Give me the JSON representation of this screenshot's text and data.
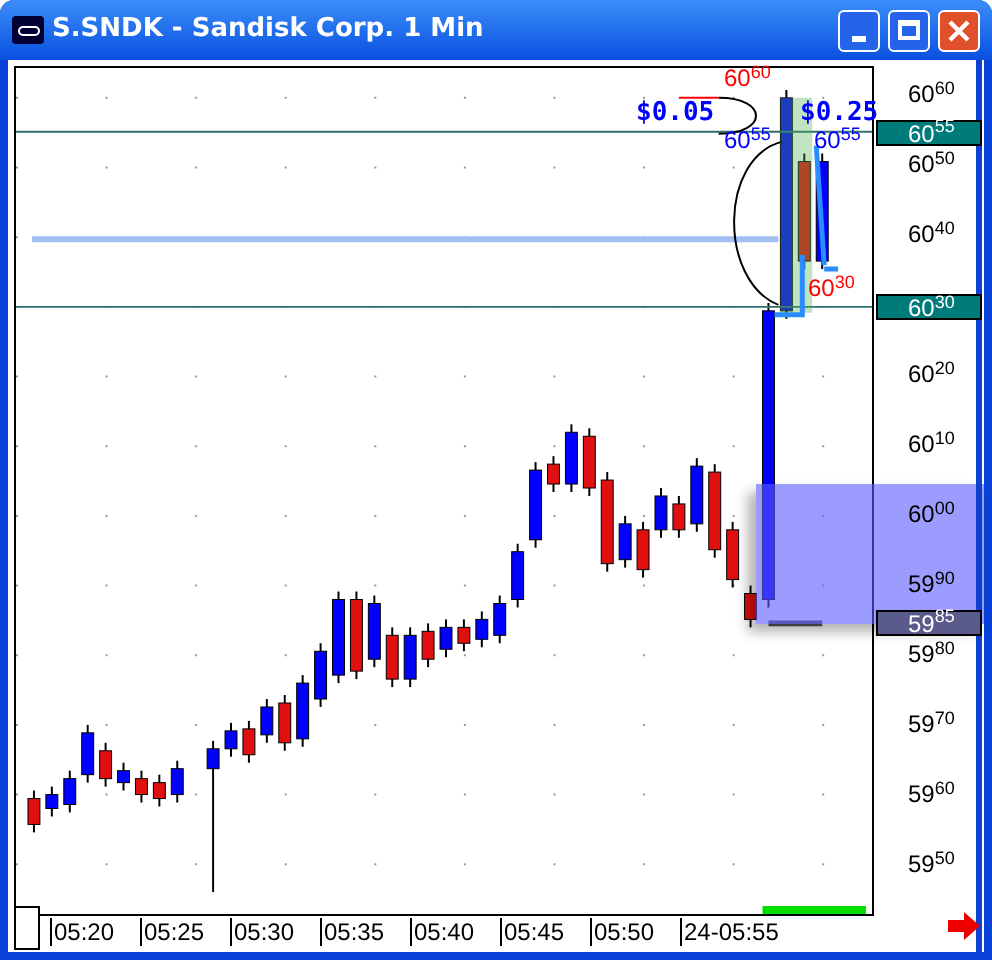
{
  "window": {
    "title": "S.SNDK - Sandisk Corp. 1 Min"
  },
  "price_axis": {
    "labels": [
      "60$^{60}$",
      "60$^{50}$",
      "60$^{40}$",
      "60$^{20}$",
      "60$^{10}$",
      "60$^{00}$",
      "59$^{90}$",
      "59$^{80}$",
      "59$^{70}$",
      "59$^{60}$",
      "59$^{50}$"
    ],
    "markers": [
      {
        "text": "60$^{55}$",
        "color": "#007b7b"
      },
      {
        "text": "60$^{30}$",
        "color": "#007b7b"
      },
      {
        "text": "59$^{85}$",
        "color": "#5a5a8c"
      }
    ]
  },
  "annotations": [
    {
      "text": "60$^{60}$",
      "color": "#ff0000"
    },
    {
      "text": "$0.05",
      "color": "#0000ff"
    },
    {
      "text": "$0.25",
      "color": "#0000ff"
    },
    {
      "text": "60$^{55}$",
      "color": "#0000ff"
    },
    {
      "text": "60$^{55}$",
      "color": "#0000ff"
    },
    {
      "text": "60$^{30}$",
      "color": "#ff0000"
    }
  ],
  "time_axis": {
    "labels": [
      "05:20",
      "05:25",
      "05:30",
      "05:35",
      "05:40",
      "05:45",
      "05:50",
      "24-05:55"
    ]
  }
}
